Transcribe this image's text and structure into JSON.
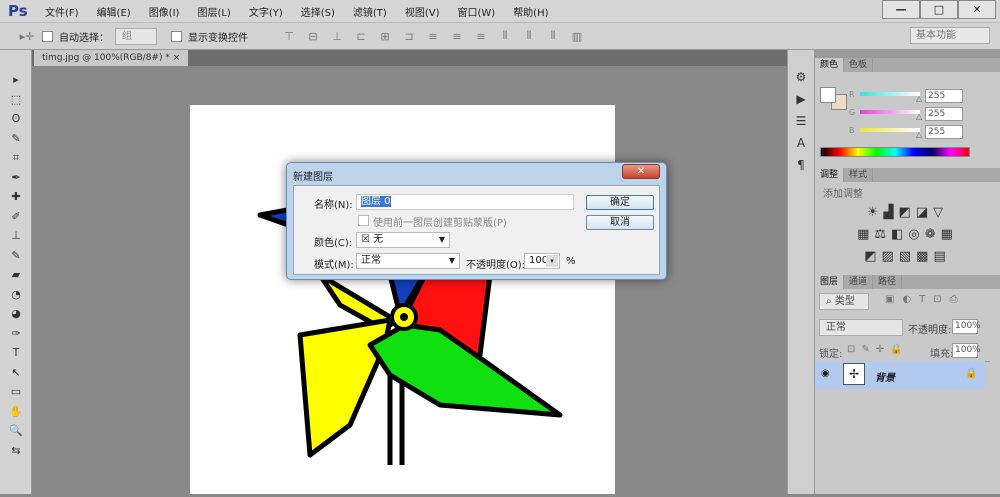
{
  "app": {
    "logo": "Ps",
    "menus": [
      "文件(F)",
      "编辑(E)",
      "图像(I)",
      "图层(L)",
      "文字(Y)",
      "选择(S)",
      "滤镜(T)",
      "视图(V)",
      "窗口(W)",
      "帮助(H)"
    ],
    "window_buttons": [
      "—",
      "□",
      "✕"
    ]
  },
  "options": {
    "auto_select_label": "自动选择：",
    "auto_select_value": "组",
    "show_transform_label": "显示变换控件",
    "workspace": "基本功能"
  },
  "document": {
    "tab_title": "timg.jpg @ 100%(RGB/8#) *",
    "close": "×"
  },
  "tools": [
    "▸",
    "⬚",
    "ʘ",
    "✎",
    "⌗",
    "✒",
    "✚",
    "✐",
    "⊥",
    "✎",
    "▰",
    "◔",
    "◕",
    "✑",
    "T",
    "↖",
    "▭",
    "✋",
    "🔍",
    "⇆"
  ],
  "dock": [
    "⚙",
    "▶",
    "☰",
    "A",
    "¶"
  ],
  "color_panel": {
    "tabs": [
      "颜色",
      "色板"
    ],
    "channels": [
      {
        "label": "R",
        "value": "255",
        "color": "#3fe0e0"
      },
      {
        "label": "G",
        "value": "255",
        "color": "#e040e0"
      },
      {
        "label": "B",
        "value": "255",
        "color": "#e8e83a"
      }
    ]
  },
  "adjust_panel": {
    "tabs": [
      "调整",
      "样式"
    ],
    "title": "添加调整",
    "icons": [
      [
        "☀",
        "▟",
        "◩",
        "◪",
        "▽"
      ],
      [
        "▦",
        "⚖",
        "◧",
        "◎",
        "❁",
        "▦"
      ],
      [
        "◩",
        "▨",
        "▧",
        "▩",
        "▤"
      ]
    ]
  },
  "layers_panel": {
    "tabs": [
      "图层",
      "通道",
      "路径"
    ],
    "filter": "类型",
    "mode": "正常",
    "opacity_label": "不透明度:",
    "opacity": "100%",
    "lock_label": "锁定:",
    "fill_label": "填充:",
    "fill": "100%",
    "layers": [
      {
        "name": "背景",
        "locked": true
      }
    ]
  },
  "dialog": {
    "title": "新建图层",
    "close": "✕",
    "name_label": "名称(N):",
    "name_value": "图层 0",
    "clip_label": "使用前一图层创建剪贴蒙版(P)",
    "color_label": "颜色(C):",
    "color_value": "无",
    "mode_label": "模式(M):",
    "mode_value": "正常",
    "opacity_label": "不透明度(O):",
    "opacity_value": "100",
    "percent": "%",
    "ok": "确定",
    "cancel": "取消"
  }
}
